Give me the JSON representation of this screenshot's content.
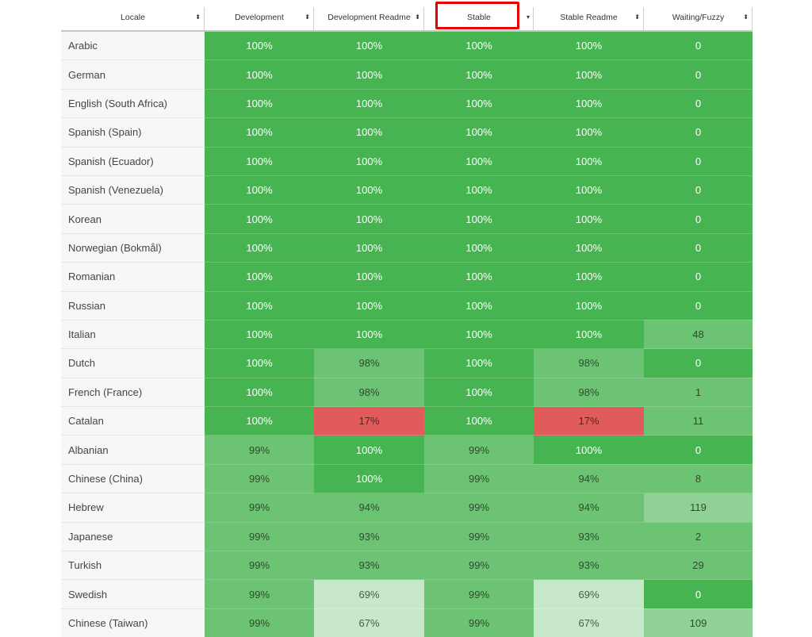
{
  "table": {
    "columns": [
      {
        "key": "locale",
        "label": "Locale",
        "sort": "both"
      },
      {
        "key": "development",
        "label": "Development",
        "sort": "both"
      },
      {
        "key": "development_readme",
        "label": "Development Readme",
        "sort": "both"
      },
      {
        "key": "stable",
        "label": "Stable",
        "sort": "desc",
        "highlighted": true
      },
      {
        "key": "stable_readme",
        "label": "Stable Readme",
        "sort": "both"
      },
      {
        "key": "waiting_fuzzy",
        "label": "Waiting/Fuzzy",
        "sort": "both"
      }
    ],
    "icons": {
      "sort_both": "⬍",
      "sort_desc": "▾"
    },
    "colors": {
      "full": "#46b450",
      "high": "#6cc374",
      "mid": "#90d296",
      "low": "#c7e8c9",
      "bad": "#e25b5b",
      "highlight_border": "#e60000"
    },
    "rows": [
      {
        "locale": "Arabic",
        "cells": [
          [
            "100%",
            "full"
          ],
          [
            "100%",
            "full"
          ],
          [
            "100%",
            "full"
          ],
          [
            "100%",
            "full"
          ],
          [
            "0",
            "full"
          ]
        ]
      },
      {
        "locale": "German",
        "cells": [
          [
            "100%",
            "full"
          ],
          [
            "100%",
            "full"
          ],
          [
            "100%",
            "full"
          ],
          [
            "100%",
            "full"
          ],
          [
            "0",
            "full"
          ]
        ]
      },
      {
        "locale": "English (South Africa)",
        "cells": [
          [
            "100%",
            "full"
          ],
          [
            "100%",
            "full"
          ],
          [
            "100%",
            "full"
          ],
          [
            "100%",
            "full"
          ],
          [
            "0",
            "full"
          ]
        ]
      },
      {
        "locale": "Spanish (Spain)",
        "cells": [
          [
            "100%",
            "full"
          ],
          [
            "100%",
            "full"
          ],
          [
            "100%",
            "full"
          ],
          [
            "100%",
            "full"
          ],
          [
            "0",
            "full"
          ]
        ]
      },
      {
        "locale": "Spanish (Ecuador)",
        "cells": [
          [
            "100%",
            "full"
          ],
          [
            "100%",
            "full"
          ],
          [
            "100%",
            "full"
          ],
          [
            "100%",
            "full"
          ],
          [
            "0",
            "full"
          ]
        ]
      },
      {
        "locale": "Spanish (Venezuela)",
        "cells": [
          [
            "100%",
            "full"
          ],
          [
            "100%",
            "full"
          ],
          [
            "100%",
            "full"
          ],
          [
            "100%",
            "full"
          ],
          [
            "0",
            "full"
          ]
        ]
      },
      {
        "locale": "Korean",
        "cells": [
          [
            "100%",
            "full"
          ],
          [
            "100%",
            "full"
          ],
          [
            "100%",
            "full"
          ],
          [
            "100%",
            "full"
          ],
          [
            "0",
            "full"
          ]
        ]
      },
      {
        "locale": "Norwegian (Bokmål)",
        "cells": [
          [
            "100%",
            "full"
          ],
          [
            "100%",
            "full"
          ],
          [
            "100%",
            "full"
          ],
          [
            "100%",
            "full"
          ],
          [
            "0",
            "full"
          ]
        ]
      },
      {
        "locale": "Romanian",
        "cells": [
          [
            "100%",
            "full"
          ],
          [
            "100%",
            "full"
          ],
          [
            "100%",
            "full"
          ],
          [
            "100%",
            "full"
          ],
          [
            "0",
            "full"
          ]
        ]
      },
      {
        "locale": "Russian",
        "cells": [
          [
            "100%",
            "full"
          ],
          [
            "100%",
            "full"
          ],
          [
            "100%",
            "full"
          ],
          [
            "100%",
            "full"
          ],
          [
            "0",
            "full"
          ]
        ]
      },
      {
        "locale": "Italian",
        "cells": [
          [
            "100%",
            "full"
          ],
          [
            "100%",
            "full"
          ],
          [
            "100%",
            "full"
          ],
          [
            "100%",
            "full"
          ],
          [
            "48",
            "high"
          ]
        ]
      },
      {
        "locale": "Dutch",
        "cells": [
          [
            "100%",
            "full"
          ],
          [
            "98%",
            "high"
          ],
          [
            "100%",
            "full"
          ],
          [
            "98%",
            "high"
          ],
          [
            "0",
            "full"
          ]
        ]
      },
      {
        "locale": "French (France)",
        "cells": [
          [
            "100%",
            "full"
          ],
          [
            "98%",
            "high"
          ],
          [
            "100%",
            "full"
          ],
          [
            "98%",
            "high"
          ],
          [
            "1",
            "high"
          ]
        ]
      },
      {
        "locale": "Catalan",
        "cells": [
          [
            "100%",
            "full"
          ],
          [
            "17%",
            "bad"
          ],
          [
            "100%",
            "full"
          ],
          [
            "17%",
            "bad"
          ],
          [
            "11",
            "high"
          ]
        ]
      },
      {
        "locale": "Albanian",
        "cells": [
          [
            "99%",
            "high"
          ],
          [
            "100%",
            "full"
          ],
          [
            "99%",
            "high"
          ],
          [
            "100%",
            "full"
          ],
          [
            "0",
            "full"
          ]
        ]
      },
      {
        "locale": "Chinese (China)",
        "cells": [
          [
            "99%",
            "high"
          ],
          [
            "100%",
            "full"
          ],
          [
            "99%",
            "high"
          ],
          [
            "94%",
            "high"
          ],
          [
            "8",
            "high"
          ]
        ]
      },
      {
        "locale": "Hebrew",
        "cells": [
          [
            "99%",
            "high"
          ],
          [
            "94%",
            "high"
          ],
          [
            "99%",
            "high"
          ],
          [
            "94%",
            "high"
          ],
          [
            "119",
            "mid"
          ]
        ]
      },
      {
        "locale": "Japanese",
        "cells": [
          [
            "99%",
            "high"
          ],
          [
            "93%",
            "high"
          ],
          [
            "99%",
            "high"
          ],
          [
            "93%",
            "high"
          ],
          [
            "2",
            "high"
          ]
        ]
      },
      {
        "locale": "Turkish",
        "cells": [
          [
            "99%",
            "high"
          ],
          [
            "93%",
            "high"
          ],
          [
            "99%",
            "high"
          ],
          [
            "93%",
            "high"
          ],
          [
            "29",
            "high"
          ]
        ]
      },
      {
        "locale": "Swedish",
        "cells": [
          [
            "99%",
            "high"
          ],
          [
            "69%",
            "low"
          ],
          [
            "99%",
            "high"
          ],
          [
            "69%",
            "low"
          ],
          [
            "0",
            "full"
          ]
        ]
      },
      {
        "locale": "Chinese (Taiwan)",
        "cells": [
          [
            "99%",
            "high"
          ],
          [
            "67%",
            "low"
          ],
          [
            "99%",
            "high"
          ],
          [
            "67%",
            "low"
          ],
          [
            "109",
            "mid"
          ]
        ]
      }
    ]
  }
}
